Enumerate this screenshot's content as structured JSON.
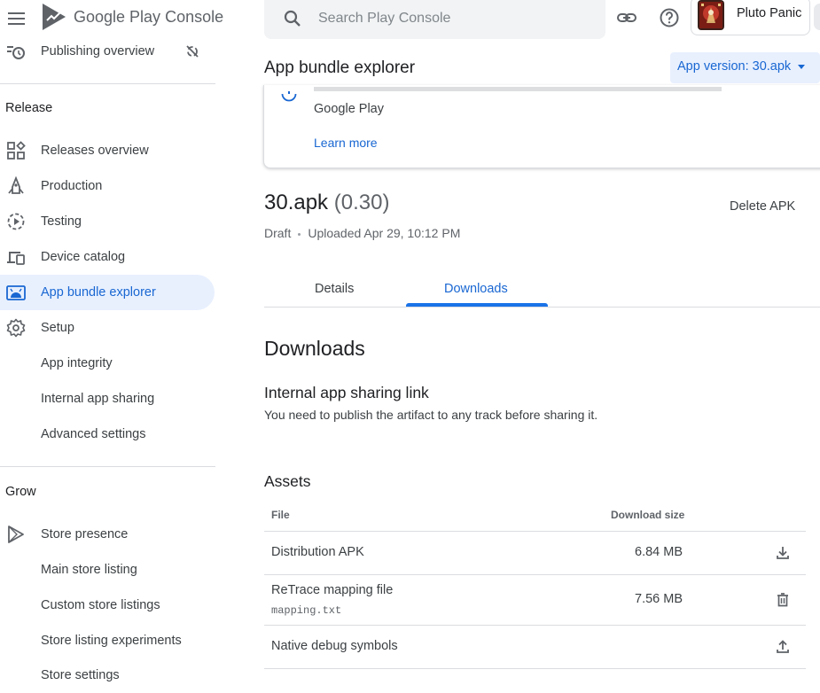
{
  "app": {
    "brand_google": "Google Play",
    "brand_console": "Console"
  },
  "sidebar": {
    "publishing_overview": "Publishing overview",
    "release_section": "Release",
    "release_items": [
      {
        "label": "Releases overview",
        "icon": "releases-overview-icon"
      },
      {
        "label": "Production",
        "icon": "production-icon"
      },
      {
        "label": "Testing",
        "icon": "testing-icon"
      },
      {
        "label": "Device catalog",
        "icon": "device-catalog-icon"
      },
      {
        "label": "App bundle explorer",
        "icon": "app-bundle-icon",
        "active": true
      },
      {
        "label": "Setup",
        "icon": "gear-icon"
      },
      {
        "label": "App integrity"
      },
      {
        "label": "Internal app sharing"
      },
      {
        "label": "Advanced settings"
      }
    ],
    "grow_section": "Grow",
    "grow_items": [
      {
        "label": "Store presence",
        "icon": "store-presence-icon"
      },
      {
        "label": "Main store listing"
      },
      {
        "label": "Custom store listings"
      },
      {
        "label": "Store listing experiments"
      },
      {
        "label": "Store settings"
      }
    ]
  },
  "header": {
    "search_placeholder": "Search Play Console",
    "account_name": "Pluto Panic"
  },
  "page": {
    "title": "App bundle explorer",
    "version_button": "App version: 30.apk"
  },
  "info_card": {
    "text": "Google Play",
    "learn_more": "Learn more"
  },
  "apk": {
    "name": "30.apk",
    "version": "(0.30)",
    "delete_label": "Delete APK",
    "status": "Draft",
    "uploaded": "Uploaded Apr 29, 10:12 PM"
  },
  "tabs": {
    "details": "Details",
    "downloads": "Downloads",
    "active": "Downloads"
  },
  "downloads": {
    "title": "Downloads",
    "sharing_title": "Internal app sharing link",
    "sharing_desc": "You need to publish the artifact to any track before sharing it.",
    "assets_title": "Assets",
    "columns": {
      "file": "File",
      "size": "Download size"
    },
    "rows": [
      {
        "file": "Distribution APK",
        "sub": "",
        "size": "6.84 MB",
        "action": "download-icon"
      },
      {
        "file": "ReTrace mapping file",
        "sub": "mapping.txt",
        "size": "7.56 MB",
        "action": "delete-icon"
      },
      {
        "file": "Native debug symbols",
        "sub": "",
        "size": "",
        "action": "upload-icon"
      }
    ]
  },
  "colors": {
    "accent": "#1967d2",
    "active_bg": "#e8f0fe",
    "text": "#202124",
    "divider": "#dadce0"
  }
}
